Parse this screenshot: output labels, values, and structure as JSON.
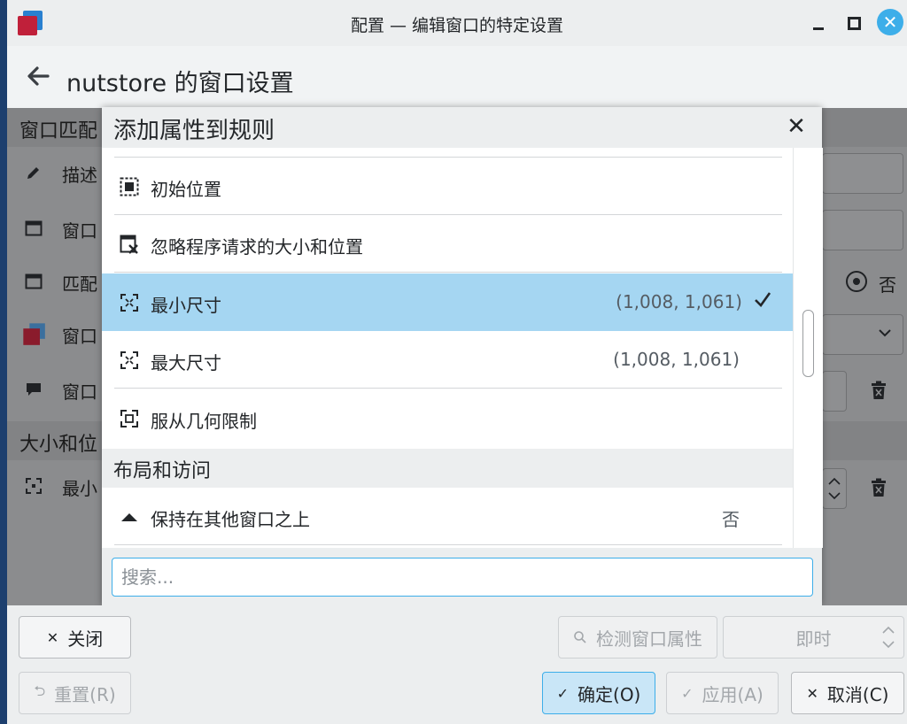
{
  "window": {
    "title": "配置 — 编辑窗口的特定设置",
    "icon": "window-rules-app-icon"
  },
  "header": {
    "page_title": "nutstore 的窗口设置"
  },
  "background": {
    "sections": [
      "窗口匹配",
      "大小和位"
    ],
    "rows": [
      {
        "icon": "pencil-icon",
        "label": "描述"
      },
      {
        "icon": "window-icon",
        "label": "窗口"
      },
      {
        "icon": "window-icon",
        "label": "匹配"
      },
      {
        "icon": "app-window-icon",
        "label": "窗口"
      },
      {
        "icon": "comment-icon",
        "label": "窗口"
      },
      {
        "icon": "resize-icon",
        "label": "最小"
      }
    ],
    "radio_no_label": "否"
  },
  "dialog": {
    "title": "添加属性到规则",
    "items": [
      {
        "icon": "position-icon",
        "label": "初始位置",
        "value": ""
      },
      {
        "icon": "ignore-geometry-icon",
        "label": "忽略程序请求的大小和位置",
        "value": ""
      },
      {
        "icon": "min-size-icon",
        "label": "最小尺寸",
        "value": "(1,008, 1,061)",
        "selected": true
      },
      {
        "icon": "max-size-icon",
        "label": "最大尺寸",
        "value": "(1,008, 1,061)"
      },
      {
        "icon": "obey-geometry-icon",
        "label": "服从几何限制",
        "value": ""
      }
    ],
    "group_header": "布局和访问",
    "group_items": [
      {
        "icon": "keep-above-icon",
        "label": "保持在其他窗口之上",
        "value": "否"
      }
    ],
    "search_placeholder": "搜索..."
  },
  "footer": {
    "close_label": "关闭",
    "detect_label": "检测窗口属性",
    "delay_label": "即时",
    "reset_label": "重置(R)",
    "ok_label": "确定(O)",
    "apply_label": "应用(A)",
    "cancel_label": "取消(C)"
  },
  "colors": {
    "accent": "#3daee9",
    "selection": "#a5d6f2",
    "dim_overlay": "#8b8c8e"
  }
}
